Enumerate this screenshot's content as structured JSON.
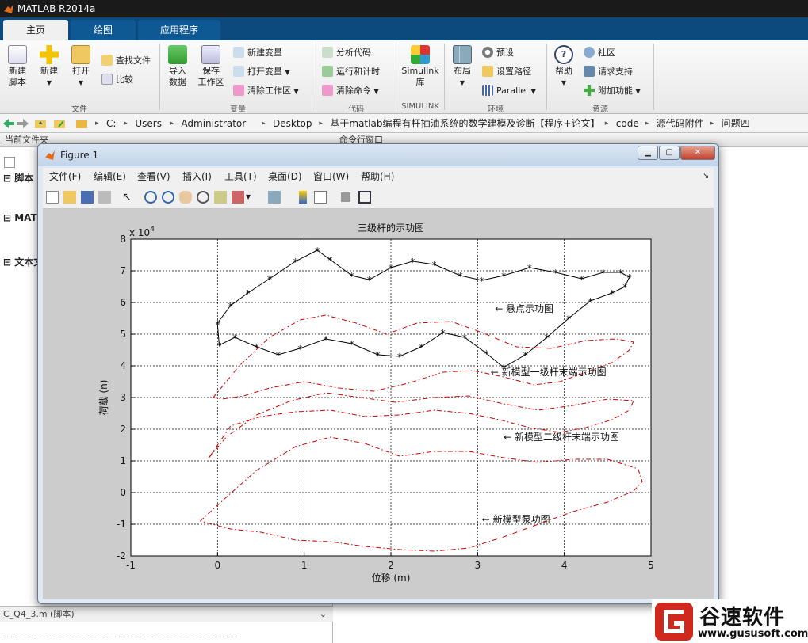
{
  "app": {
    "title": "MATLAB R2014a"
  },
  "ribbon": {
    "tabs": [
      "主页",
      "绘图",
      "应用程序"
    ],
    "file": {
      "new_script": "新建\n脚本",
      "new": "新建",
      "open": "打开",
      "find_files": "查找文件",
      "compare": "比较",
      "group": "文件"
    },
    "variable": {
      "import": "导入\n数据",
      "save": "保存\n工作区",
      "new_var": "新建变量",
      "open_var": "打开变量",
      "clear_ws": "清除工作区",
      "group": "变量"
    },
    "code": {
      "analyze": "分析代码",
      "run_time": "运行和计时",
      "clear_cmd": "清除命令",
      "group": "代码"
    },
    "simulink": {
      "lib": "Simulink\n库",
      "group": "SIMULINK"
    },
    "env": {
      "layout": "布局",
      "prefs": "预设",
      "set_path": "设置路径",
      "parallel": "Parallel",
      "group": "环境"
    },
    "resources": {
      "help": "帮助",
      "community": "社区",
      "support": "请求支持",
      "addons": "附加功能",
      "group": "资源"
    }
  },
  "address": {
    "crumbs": [
      "C:",
      "Users",
      "Administrator",
      "Desktop",
      "基于matlab编程有杆抽油系统的数学建模及诊断【程序+论文】",
      "code",
      "源代码附件",
      "问题四"
    ]
  },
  "left_panel": {
    "title": "当前文件夹",
    "sections": [
      "脚本",
      "MAT",
      "文本文"
    ],
    "bottom_file": "C_Q4_3.m (脚本)"
  },
  "command_window": {
    "title": "命令行窗口"
  },
  "figure": {
    "title": "Figure 1",
    "menu": [
      "文件(F)",
      "编辑(E)",
      "查看(V)",
      "插入(I)",
      "工具(T)",
      "桌面(D)",
      "窗口(W)",
      "帮助(H)"
    ]
  },
  "chart_data": {
    "type": "line",
    "title": "三级杆的示功图",
    "xlabel": "位移 (m)",
    "ylabel": "荷载 (n)",
    "y_multiplier": "x 10^4",
    "xlim": [
      -1,
      5
    ],
    "ylim": [
      -2,
      8
    ],
    "xticks": [
      -1,
      0,
      1,
      2,
      3,
      4,
      5
    ],
    "yticks": [
      -2,
      -1,
      0,
      1,
      2,
      3,
      4,
      5,
      6,
      7,
      8
    ],
    "grid": true,
    "series": [
      {
        "style": "asterisk-line",
        "color": "#000000",
        "x": [
          0,
          0.15,
          0.35,
          0.6,
          0.9,
          1.15,
          1.3,
          1.55,
          1.75,
          2.0,
          2.25,
          2.5,
          2.8,
          3.05,
          3.3,
          3.6,
          3.9,
          4.2,
          4.45,
          4.65,
          4.75,
          4.7,
          4.55,
          4.3,
          4.05,
          3.8,
          3.55,
          3.3,
          3.1,
          2.85,
          2.6,
          2.35,
          2.1,
          1.85,
          1.55,
          1.25,
          0.95,
          0.7,
          0.45,
          0.2,
          0.02,
          0.0
        ],
        "y": [
          5.35,
          5.9,
          6.3,
          6.75,
          7.3,
          7.65,
          7.35,
          6.85,
          6.72,
          7.1,
          7.3,
          7.2,
          6.85,
          6.7,
          6.85,
          7.1,
          6.95,
          6.75,
          6.95,
          6.95,
          6.8,
          6.5,
          6.3,
          6.05,
          5.5,
          4.9,
          4.35,
          3.95,
          4.4,
          4.9,
          5.05,
          4.6,
          4.3,
          4.35,
          4.7,
          4.85,
          4.55,
          4.35,
          4.6,
          4.9,
          4.65,
          5.3
        ]
      },
      {
        "style": "dashdot",
        "color": "#cc0000",
        "x": [
          -0.05,
          0.25,
          0.6,
          0.95,
          1.25,
          1.6,
          1.95,
          2.3,
          2.7,
          3.05,
          3.45,
          3.85,
          4.25,
          4.6,
          4.8,
          4.75,
          4.55,
          4.25,
          3.95,
          3.65,
          3.3,
          2.95,
          2.6,
          2.2,
          1.8,
          1.4,
          1.0,
          0.6,
          0.3,
          0.05,
          -0.05
        ],
        "y": [
          3.0,
          4.0,
          4.9,
          5.45,
          5.6,
          5.35,
          5.0,
          5.35,
          5.4,
          5.05,
          4.6,
          4.55,
          4.8,
          4.85,
          4.75,
          4.5,
          4.1,
          3.8,
          3.5,
          3.4,
          3.65,
          3.85,
          3.8,
          3.45,
          3.2,
          3.3,
          3.5,
          3.3,
          3.05,
          2.95,
          3.0
        ]
      },
      {
        "style": "dashdot",
        "color": "#cc0000",
        "x": [
          -0.1,
          0.1,
          0.45,
          0.85,
          1.25,
          1.65,
          2.05,
          2.5,
          2.9,
          3.3,
          3.7,
          4.1,
          4.5,
          4.8,
          4.75,
          4.55,
          4.25,
          3.95,
          3.6,
          3.25,
          2.9,
          2.5,
          2.1,
          1.7,
          1.3,
          0.9,
          0.5,
          0.15,
          -0.1
        ],
        "y": [
          1.1,
          1.75,
          2.45,
          2.9,
          3.15,
          3.0,
          2.85,
          3.0,
          3.05,
          2.8,
          2.6,
          2.75,
          2.95,
          2.9,
          2.6,
          2.3,
          2.05,
          1.9,
          2.05,
          2.3,
          2.5,
          2.6,
          2.45,
          2.4,
          2.6,
          2.55,
          2.4,
          2.1,
          1.1
        ]
      },
      {
        "style": "dashdot",
        "color": "#cc0000",
        "x": [
          -0.2,
          0.1,
          0.45,
          0.9,
          1.3,
          1.7,
          2.1,
          2.5,
          2.9,
          3.3,
          3.7,
          4.1,
          4.5,
          4.85,
          4.9,
          4.8,
          4.5,
          4.1,
          3.7,
          3.3,
          2.9,
          2.5,
          2.1,
          1.7,
          1.3,
          0.9,
          0.5,
          0.15,
          -0.2
        ],
        "y": [
          -0.9,
          -0.15,
          0.7,
          1.45,
          1.75,
          1.55,
          1.15,
          1.3,
          1.3,
          1.1,
          0.95,
          1.05,
          1.05,
          0.75,
          0.35,
          0.05,
          -0.3,
          -0.6,
          -1.0,
          -1.4,
          -1.75,
          -1.85,
          -1.8,
          -1.7,
          -1.55,
          -1.5,
          -1.25,
          -1.15,
          -0.9
        ]
      }
    ],
    "annotations": [
      {
        "text": "← 悬点示功图",
        "x": 3.2,
        "y": 5.8
      },
      {
        "text": "← 新模型一级杆末端示功图",
        "x": 3.15,
        "y": 3.8
      },
      {
        "text": "← 新模型二级杆末端示功图",
        "x": 3.3,
        "y": 1.75
      },
      {
        "text": "← 新模型泵功图",
        "x": 3.05,
        "y": -0.85
      }
    ]
  },
  "watermark": {
    "text": "谷速软件",
    "url": "www.gususoft.com"
  }
}
